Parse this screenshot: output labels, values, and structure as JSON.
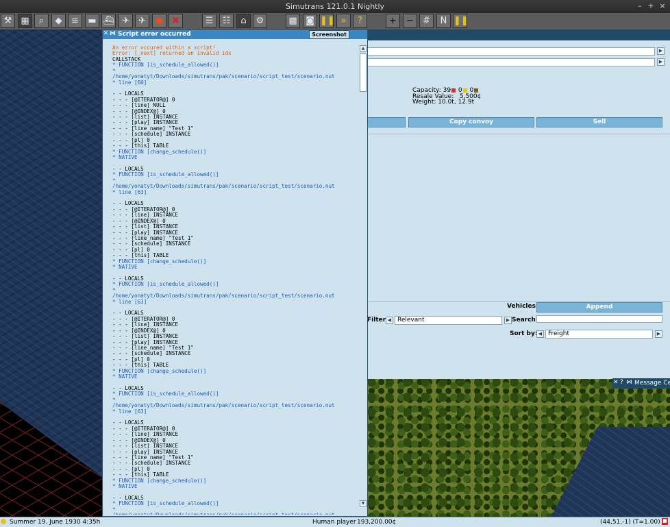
{
  "window": {
    "title": "Simutrans 121.0.1 Nightly",
    "minimize": "–",
    "maximize": "+",
    "close": "×"
  },
  "toolbar": {
    "icons": [
      "wrench-icon",
      "map-icon",
      "magnifier-icon",
      "terrain-icon",
      "rail-icon",
      "road-icon",
      "ship-icon",
      "air-icon",
      "airplane-icon",
      "special-icon",
      "remove-icon",
      "schedule-icon",
      "list-icon",
      "depot-icon",
      "factory-icon",
      "minimap-icon",
      "camera-icon",
      "pause-icon",
      "fastforward-icon",
      "help-icon",
      "zoom-in-icon",
      "zoom-out-icon",
      "grid-icon",
      "compass-icon",
      "pause2-icon"
    ]
  },
  "error_dialog": {
    "title": "Script error occurred",
    "screenshot_label": "Screenshot",
    "lines": [
      {
        "t": "An error occured within a script!",
        "c": "err"
      },
      {
        "t": "Error: [_next] returned an invalid idx",
        "c": "err"
      },
      {
        "t": "CALLSTACK",
        "c": "blk"
      },
      {
        "t": "* FUNCTION [is_schedule_allowed()]",
        "c": "fn"
      },
      {
        "t": "*",
        "c": "fn"
      },
      {
        "t": "/home/yonatyt/Downloads/simutrans/pak/scenario/script_test/scenario.nut",
        "c": "fn"
      },
      {
        "t": "* line [60]",
        "c": "fn"
      },
      {
        "t": "",
        "c": "blk"
      },
      {
        "t": "- - LOCALS",
        "c": "blk"
      },
      {
        "t": "- - - [@ITERATOR@] 0",
        "c": "blk"
      },
      {
        "t": "- - - [line] NULL",
        "c": "blk"
      },
      {
        "t": "- - - [@INDEX@] 0",
        "c": "blk"
      },
      {
        "t": "- - - [list] INSTANCE",
        "c": "blk"
      },
      {
        "t": "- - - [play] INSTANCE",
        "c": "blk"
      },
      {
        "t": "- - - [line_name] \"Test 1\"",
        "c": "blk"
      },
      {
        "t": "- - - [schedule] INSTANCE",
        "c": "blk"
      },
      {
        "t": "- - - [pl] 0",
        "c": "blk"
      },
      {
        "t": "- - - [this] TABLE",
        "c": "blk"
      },
      {
        "t": "* FUNCTION [change_schedule()]",
        "c": "fn"
      },
      {
        "t": "* NATIVE",
        "c": "fn"
      },
      {
        "t": "",
        "c": "blk"
      },
      {
        "t": "- - LOCALS",
        "c": "blk"
      },
      {
        "t": "* FUNCTION [is_schedule_allowed()]",
        "c": "fn"
      },
      {
        "t": "*",
        "c": "fn"
      },
      {
        "t": "/home/yonatyt/Downloads/simutrans/pak/scenario/script_test/scenario.nut",
        "c": "fn"
      },
      {
        "t": "* line [63]",
        "c": "fn"
      },
      {
        "t": "",
        "c": "blk"
      },
      {
        "t": "- - LOCALS",
        "c": "blk"
      },
      {
        "t": "- - - [@ITERATOR@] 0",
        "c": "blk"
      },
      {
        "t": "- - - [line] INSTANCE",
        "c": "blk"
      },
      {
        "t": "- - - [@INDEX@] 0",
        "c": "blk"
      },
      {
        "t": "- - - [list] INSTANCE",
        "c": "blk"
      },
      {
        "t": "- - - [play] INSTANCE",
        "c": "blk"
      },
      {
        "t": "- - - [line_name] \"Test 1\"",
        "c": "blk"
      },
      {
        "t": "- - - [schedule] INSTANCE",
        "c": "blk"
      },
      {
        "t": "- - - [pl] 0",
        "c": "blk"
      },
      {
        "t": "- - - [this] TABLE",
        "c": "blk"
      },
      {
        "t": "* FUNCTION [change_schedule()]",
        "c": "fn"
      },
      {
        "t": "* NATIVE",
        "c": "fn"
      },
      {
        "t": "",
        "c": "blk"
      },
      {
        "t": "- - LOCALS",
        "c": "blk"
      },
      {
        "t": "* FUNCTION [is_schedule_allowed()]",
        "c": "fn"
      },
      {
        "t": "*",
        "c": "fn"
      },
      {
        "t": "/home/yonatyt/Downloads/simutrans/pak/scenario/script_test/scenario.nut",
        "c": "fn"
      },
      {
        "t": "* line [63]",
        "c": "fn"
      },
      {
        "t": "",
        "c": "blk"
      },
      {
        "t": "- - LOCALS",
        "c": "blk"
      },
      {
        "t": "- - - [@ITERATOR@] 0",
        "c": "blk"
      },
      {
        "t": "- - - [line] INSTANCE",
        "c": "blk"
      },
      {
        "t": "- - - [@INDEX@] 0",
        "c": "blk"
      },
      {
        "t": "- - - [list] INSTANCE",
        "c": "blk"
      },
      {
        "t": "- - - [play] INSTANCE",
        "c": "blk"
      },
      {
        "t": "- - - [line_name] \"Test 1\"",
        "c": "blk"
      },
      {
        "t": "- - - [schedule] INSTANCE",
        "c": "blk"
      },
      {
        "t": "- - - [pl] 0",
        "c": "blk"
      },
      {
        "t": "- - - [this] TABLE",
        "c": "blk"
      },
      {
        "t": "* FUNCTION [change_schedule()]",
        "c": "fn"
      },
      {
        "t": "* NATIVE",
        "c": "fn"
      },
      {
        "t": "",
        "c": "blk"
      },
      {
        "t": "- - LOCALS",
        "c": "blk"
      },
      {
        "t": "* FUNCTION [is_schedule_allowed()]",
        "c": "fn"
      },
      {
        "t": "*",
        "c": "fn"
      },
      {
        "t": "/home/yonatyt/Downloads/simutrans/pak/scenario/script_test/scenario.nut",
        "c": "fn"
      },
      {
        "t": "* line [63]",
        "c": "fn"
      },
      {
        "t": "",
        "c": "blk"
      },
      {
        "t": "- - LOCALS",
        "c": "blk"
      },
      {
        "t": "- - - [@ITERATOR@] 0",
        "c": "blk"
      },
      {
        "t": "- - - [line] INSTANCE",
        "c": "blk"
      },
      {
        "t": "- - - [@INDEX@] 0",
        "c": "blk"
      },
      {
        "t": "- - - [list] INSTANCE",
        "c": "blk"
      },
      {
        "t": "- - - [play] INSTANCE",
        "c": "blk"
      },
      {
        "t": "- - - [line_name] \"Test 1\"",
        "c": "blk"
      },
      {
        "t": "- - - [schedule] INSTANCE",
        "c": "blk"
      },
      {
        "t": "- - - [pl] 0",
        "c": "blk"
      },
      {
        "t": "- - - [this] TABLE",
        "c": "blk"
      },
      {
        "t": "* FUNCTION [change_schedule()]",
        "c": "fn"
      },
      {
        "t": "* NATIVE",
        "c": "fn"
      },
      {
        "t": "",
        "c": "blk"
      },
      {
        "t": "- - LOCALS",
        "c": "blk"
      },
      {
        "t": "* FUNCTION [is_schedule_allowed()]",
        "c": "fn"
      },
      {
        "t": "*",
        "c": "fn"
      },
      {
        "t": "/home/yonatyt/Downloads/simutrans/pak/scenario/script_test/scenario.nut",
        "c": "fn"
      }
    ]
  },
  "convoy_panel": {
    "capacity_label": "Capacity:",
    "capacity_pass": "39",
    "capacity_mail": "0",
    "capacity_goods": "0",
    "resale_label": "Resale Value:",
    "resale_value": "5,500¢",
    "weight_label": "Weight:",
    "weight_value": "10.0t, 12.9t",
    "copy_convoy": "Copy convoy",
    "sell": "Sell",
    "vehicles_label": "Vehicles:",
    "append": "Append",
    "filter_label": "Filter:",
    "filter_value": "Relevant",
    "search_label": "Search:",
    "search_value": "",
    "sortby_label": "Sort by:",
    "sortby_value": "Freight"
  },
  "message_center": {
    "title": "Message Ce"
  },
  "statusbar": {
    "date": "Summer 19. June 1930  4:35h",
    "player": "Human player",
    "money": "193,200.00¢",
    "coords": "(44,51,-1) (T=1.00)"
  },
  "colors": {
    "error_orange": "#e06010",
    "function_blue": "#1c5bb8",
    "button_blue": "#7ab3d8"
  }
}
